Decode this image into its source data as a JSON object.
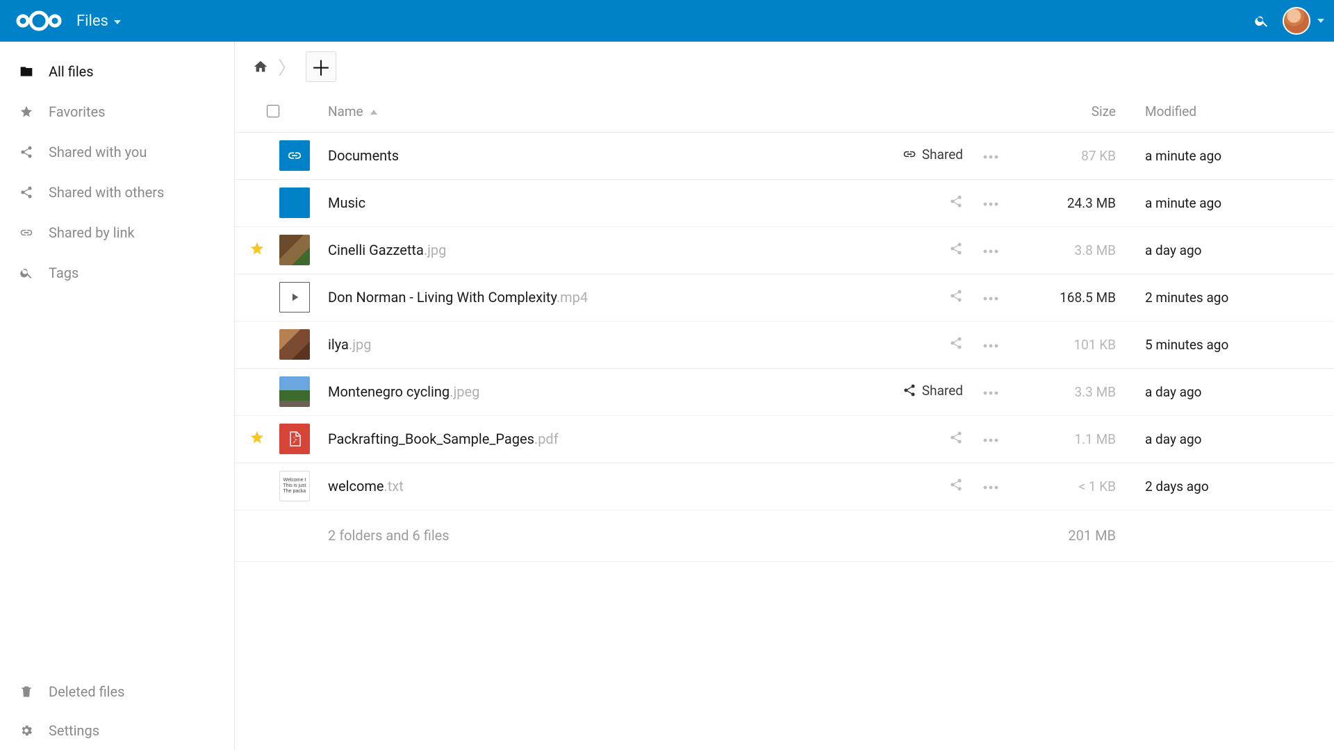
{
  "colors": {
    "accent": "#0082c9",
    "star": "#f9c622",
    "pdf": "#d84338"
  },
  "header": {
    "app_label": "Files"
  },
  "sidebar": {
    "items": [
      {
        "icon": "folder",
        "label": "All files",
        "active": true
      },
      {
        "icon": "star",
        "label": "Favorites"
      },
      {
        "icon": "share",
        "label": "Shared with you"
      },
      {
        "icon": "share",
        "label": "Shared with others"
      },
      {
        "icon": "link",
        "label": "Shared by link"
      },
      {
        "icon": "search",
        "label": "Tags"
      }
    ],
    "bottom": [
      {
        "icon": "trash",
        "label": "Deleted files"
      },
      {
        "icon": "gear",
        "label": "Settings"
      }
    ]
  },
  "columns": {
    "name": "Name",
    "size": "Size",
    "modified": "Modified"
  },
  "shared_label": "Shared",
  "files": [
    {
      "star": false,
      "thumb": "folder-link",
      "name": "Documents",
      "ext": "",
      "share": "link",
      "size": "87 KB",
      "size_dim": true,
      "modified": "a minute ago"
    },
    {
      "star": false,
      "thumb": "folder",
      "name": "Music",
      "ext": "",
      "share": "icon",
      "size": "24.3 MB",
      "size_dim": false,
      "modified": "a minute ago"
    },
    {
      "star": true,
      "thumb": "img1",
      "name": "Cinelli Gazzetta",
      "ext": ".jpg",
      "share": "icon",
      "size": "3.8 MB",
      "size_dim": true,
      "modified": "a day ago"
    },
    {
      "star": false,
      "thumb": "video",
      "name": "Don Norman - Living With Complexity",
      "ext": ".mp4",
      "share": "icon",
      "size": "168.5 MB",
      "size_dim": false,
      "modified": "2 minutes ago"
    },
    {
      "star": false,
      "thumb": "img2",
      "name": "ilya",
      "ext": ".jpg",
      "share": "icon",
      "size": "101 KB",
      "size_dim": true,
      "modified": "5 minutes ago"
    },
    {
      "star": false,
      "thumb": "img3",
      "name": "Montenegro cycling",
      "ext": ".jpeg",
      "share": "shared",
      "size": "3.3 MB",
      "size_dim": true,
      "modified": "a day ago"
    },
    {
      "star": true,
      "thumb": "pdf",
      "name": "Packrafting_Book_Sample_Pages",
      "ext": ".pdf",
      "share": "icon",
      "size": "1.1 MB",
      "size_dim": true,
      "modified": "a day ago"
    },
    {
      "star": false,
      "thumb": "txt",
      "name": "welcome",
      "ext": ".txt",
      "share": "icon",
      "size": "< 1 KB",
      "size_dim": true,
      "modified": "2 days ago"
    }
  ],
  "txt_preview": {
    "l1": "Welcome t",
    "l2": "This is just",
    "l3": "The packa"
  },
  "footer": {
    "summary": "2 folders and 6 files",
    "total_size": "201 MB"
  }
}
